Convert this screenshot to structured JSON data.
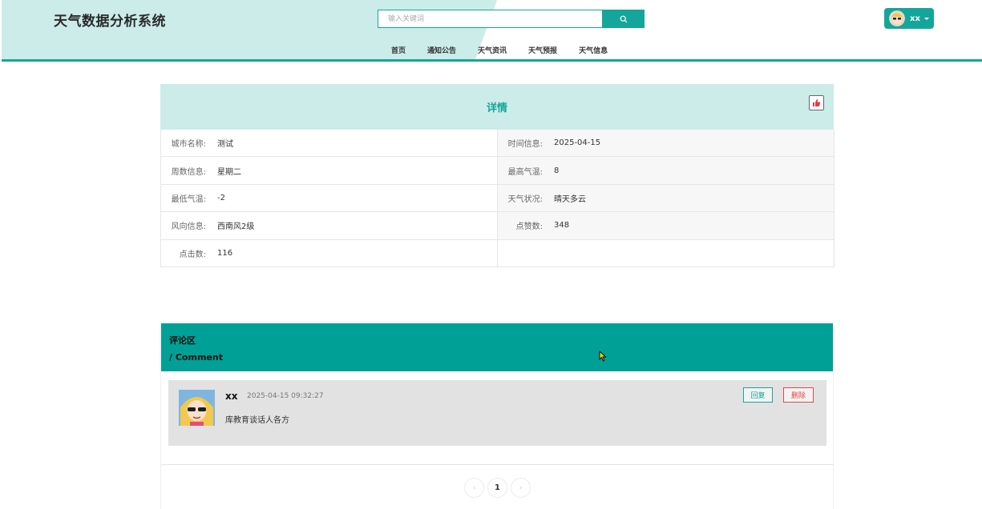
{
  "header": {
    "site_title": "天气数据分析系统",
    "search_placeholder": "输入关键词",
    "nav": [
      "首页",
      "通知公告",
      "天气资讯",
      "天气预报",
      "天气信息"
    ],
    "user_name": "xx",
    "accent_color": "#14a69a"
  },
  "detail": {
    "title": "详情",
    "fields": [
      {
        "label": "城市名称:",
        "value": "测试"
      },
      {
        "label": "时间信息:",
        "value": "2025-04-15"
      },
      {
        "label": "周数信息:",
        "value": "星期二"
      },
      {
        "label": "最高气温:",
        "value": "8"
      },
      {
        "label": "最低气温:",
        "value": "-2"
      },
      {
        "label": "天气状况:",
        "value": "晴天多云"
      },
      {
        "label": "风向信息:",
        "value": "西南风2级"
      },
      {
        "label": "点赞数:",
        "value": "348"
      },
      {
        "label": "点击数:",
        "value": "116"
      }
    ]
  },
  "comments": {
    "title": "评论区",
    "subtitle": "/ Comment",
    "items": [
      {
        "user": "xx",
        "time": "2025-04-15 09:32:27",
        "text": "库教育谈话人各方",
        "reply_label": "回复",
        "delete_label": "删除"
      }
    ],
    "pagination": {
      "prev": "‹",
      "current": "1",
      "next": "›"
    }
  }
}
